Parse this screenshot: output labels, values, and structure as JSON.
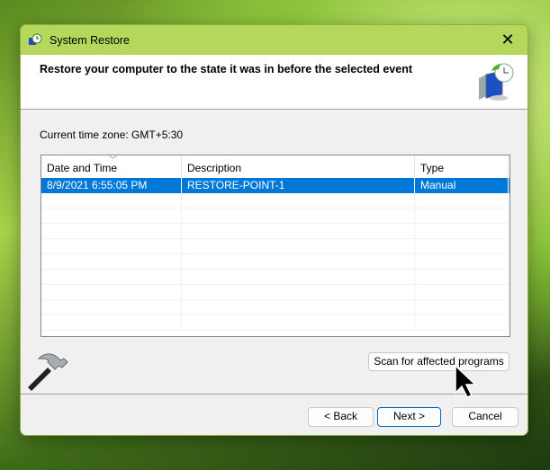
{
  "window": {
    "title": "System Restore",
    "close_label": "✕"
  },
  "header": {
    "heading": "Restore your computer to the state it was in before the selected event"
  },
  "timezone": "Current time zone: GMT+5:30",
  "table": {
    "columns": [
      "Date and Time",
      "Description",
      "Type"
    ],
    "rows": [
      {
        "date": "8/9/2021 6:55:05 PM",
        "description": "RESTORE-POINT-1",
        "type": "Manual",
        "selected": true
      }
    ]
  },
  "buttons": {
    "scan": "Scan for affected programs",
    "back": "< Back",
    "next": "Next >",
    "cancel": "Cancel"
  },
  "colors": {
    "titlebar": "#b5d85c",
    "selection": "#0078d7"
  }
}
